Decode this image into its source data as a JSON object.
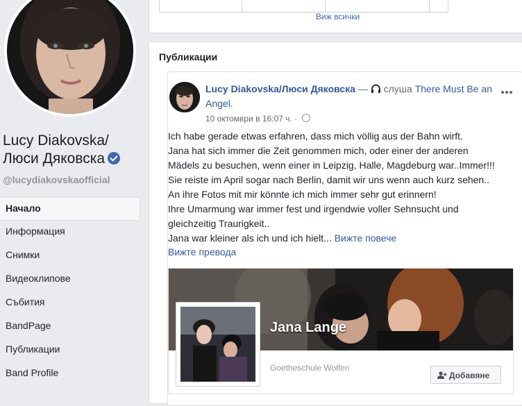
{
  "profile": {
    "name": "Lucy Diakovska/ Люси Дяковска",
    "username": "@lucydiakovskaofficial"
  },
  "nav": {
    "items": [
      {
        "label": "Начало"
      },
      {
        "label": "Информация"
      },
      {
        "label": "Снимки"
      },
      {
        "label": "Видеоклипове"
      },
      {
        "label": "Събития"
      },
      {
        "label": "BandPage"
      },
      {
        "label": "Публикации"
      },
      {
        "label": "Band Profile"
      }
    ]
  },
  "top_card": {
    "see_all": "Виж всички"
  },
  "publications": {
    "title": "Публикации",
    "post": {
      "author": "Lucy Diakovska/Люси Дяковска",
      "dash": " — ",
      "activity": "слуша",
      "song": "There Must Be an Angel",
      "song_suffix": ".",
      "timestamp": "10 октомври в 16:07 ч.",
      "separator": " · ",
      "text_lines": [
        "Ich habe gerade etwas erfahren, dass mich völlig aus der Bahn wirft.",
        "Jana hat sich immer die Zeit genommen mich, oder einer der anderen",
        "Mädels zu besuchen, wenn einer in Leipzig, Halle, Magdeburg war..Immer!!!",
        "Sie reiste im April sogar nach Berlin, damit wir uns wenn auch kurz sehen..",
        "An ihre Fotos mit mir könnte ich mich immer sehr gut erinnern!",
        "Ihre Umarmung war immer fest und irgendwie voller Sehnsucht und",
        "gleichzeitig Traurigkeit.."
      ],
      "last_line": "Jana war kleiner als ich und ich hielt...",
      "see_more": "Вижте повече",
      "translate": "Вижте превода",
      "link_card": {
        "title": "Jana Lange",
        "subtitle": "Goetheschule Wolfen",
        "button": "Добавяне"
      }
    }
  },
  "colors": {
    "link": "#365899",
    "background": "#e9ebee",
    "verified": "#4267b2"
  },
  "icons": {
    "verified": "verified-badge-icon",
    "headphones": "headphones-icon",
    "globe": "globe-icon",
    "more": "more-options-icon",
    "add_friend": "add-friend-icon"
  }
}
